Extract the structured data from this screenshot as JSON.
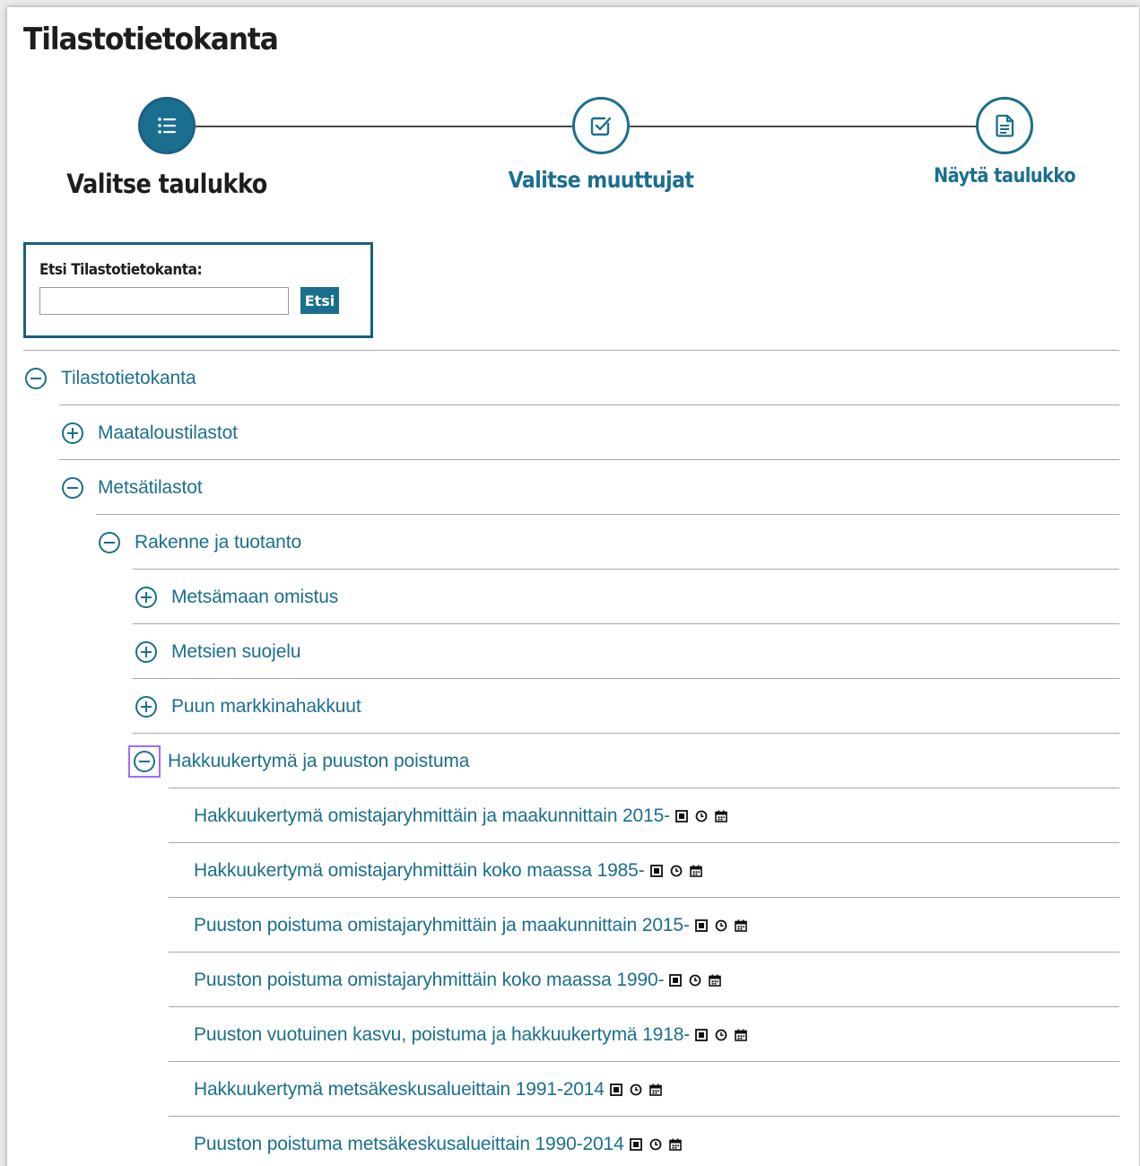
{
  "app": {
    "title": "Tilastotietokanta"
  },
  "stepper": {
    "steps": [
      {
        "label": "Valitse taulukko",
        "icon": "list-icon",
        "active": true
      },
      {
        "label": "Valitse muuttujat",
        "icon": "checkbox-icon",
        "active": false
      },
      {
        "label": "Näytä taulukko",
        "icon": "document-icon",
        "active": false
      }
    ]
  },
  "search": {
    "label": "Etsi Tilastotietokanta:",
    "value": "",
    "placeholder": "",
    "button_label": "Etsi"
  },
  "tree": {
    "root": {
      "label": "Tilastotietokanta",
      "state": "expanded"
    },
    "level1": [
      {
        "label": "Maataloustilastot",
        "state": "collapsed"
      },
      {
        "label": "Metsätilastot",
        "state": "expanded"
      }
    ],
    "level2": [
      {
        "label": "Rakenne ja tuotanto",
        "state": "expanded"
      }
    ],
    "level3": [
      {
        "label": "Metsämaan omistus",
        "state": "collapsed"
      },
      {
        "label": "Metsien suojelu",
        "state": "collapsed"
      },
      {
        "label": "Puun markkinahakkuut",
        "state": "collapsed"
      },
      {
        "label": "Hakkuukertymä ja puuston poistuma",
        "state": "expanded",
        "focused": true
      }
    ],
    "tables": [
      {
        "label": "Hakkuukertymä omistajaryhmittäin ja maakunnittain 2015-",
        "icons": [
          "table-info-icon",
          "clock-icon",
          "calendar-icon"
        ]
      },
      {
        "label": "Hakkuukertymä omistajaryhmittäin koko maassa 1985-",
        "icons": [
          "table-info-icon",
          "clock-icon",
          "calendar-icon"
        ]
      },
      {
        "label": "Puuston poistuma omistajaryhmittäin ja maakunnittain 2015-",
        "icons": [
          "table-info-icon",
          "clock-icon",
          "calendar-icon"
        ]
      },
      {
        "label": "Puuston poistuma omistajaryhmittäin koko maassa 1990-",
        "icons": [
          "table-info-icon",
          "clock-icon",
          "calendar-icon"
        ]
      },
      {
        "label": "Puuston vuotuinen kasvu, poistuma ja hakkuukertymä 1918-",
        "icons": [
          "table-info-icon",
          "clock-icon",
          "calendar-icon"
        ]
      },
      {
        "label": "Hakkuukertymä metsäkeskusalueittain 1991-2014",
        "icons": [
          "table-info-icon",
          "clock-icon",
          "calendar-icon"
        ]
      },
      {
        "label": "Puuston poistuma metsäkeskusalueittain 1990-2014",
        "icons": [
          "table-info-icon",
          "clock-icon",
          "calendar-icon"
        ]
      }
    ]
  },
  "colors": {
    "accent": "#1b6f8e",
    "border": "#1a5f7a",
    "focus": "#9b6cff",
    "text": "#1d1d1d"
  }
}
